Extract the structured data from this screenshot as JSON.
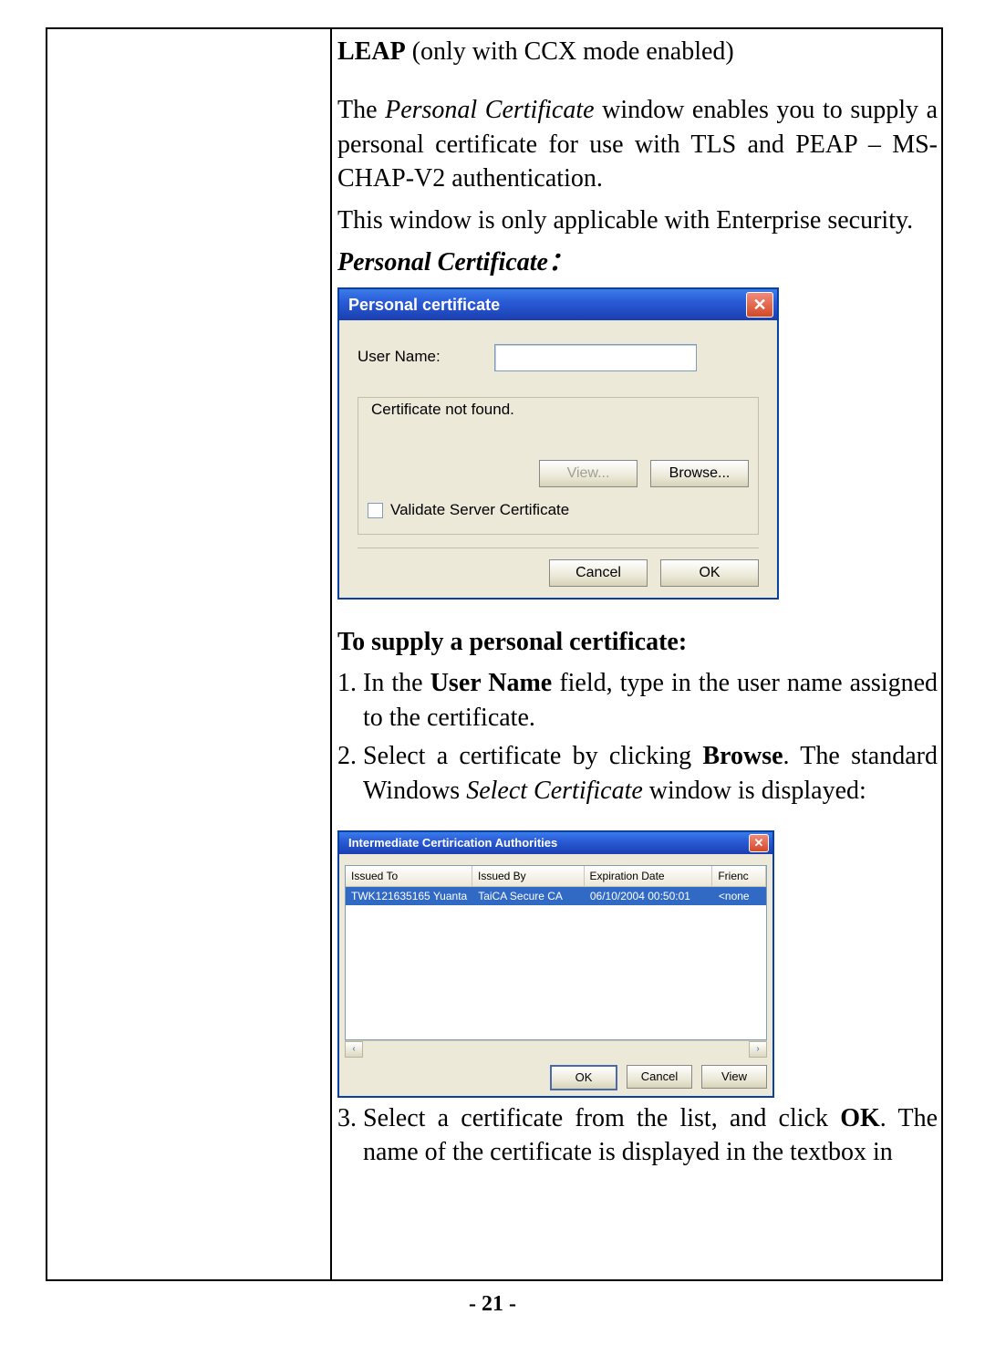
{
  "text": {
    "leap_bold": "LEAP",
    "leap_rest": " (only with CCX mode enabled)",
    "para1_a": "The ",
    "para1_b": "Personal Certificate",
    "para1_c": " window enables you to supply a personal certificate for use with TLS and PEAP – MS-CHAP-V2 authentication.",
    "para2": "This window is only applicable with Enterprise security.",
    "pcert_heading": "Personal Certificate：",
    "supply_heading": "To supply a personal certificate:",
    "li1_a": "In the ",
    "li1_b": "User Name",
    "li1_c": " field, type in the user name assigned to the certificate.",
    "li2_a": "Select a certificate by clicking ",
    "li2_b": "Browse",
    "li2_c": ". The standard Windows ",
    "li2_d": "Select Certificate",
    "li2_e": " window is displayed:",
    "li3_a": "Select a certificate from the list, and click ",
    "li3_b": "OK",
    "li3_c": ". The name of the certificate is displayed in the textbox in",
    "page_num": "- 21 -"
  },
  "dlg1": {
    "title": "Personal certificate",
    "user_name_lbl": "User Name:",
    "cert_not_found": "Certificate not found.",
    "view_btn": "View...",
    "browse_btn": "Browse...",
    "validate_lbl": "Validate Server Certificate",
    "cancel_btn": "Cancel",
    "ok_btn": "OK"
  },
  "dlg2": {
    "title": "Intermediate Certirication Authorities",
    "hdr_issued_to": "Issued To",
    "hdr_issued_by": "Issued By",
    "hdr_exp": "Expiration Date",
    "hdr_friendly": "Frienc",
    "row_issued_to": "TWK121635165 Yuanta",
    "row_issued_by": "TaiCA Secure CA",
    "row_exp": "06/10/2004 00:50:01",
    "row_friendly": "<none",
    "ok_btn": "OK",
    "cancel_btn": "Cancel",
    "view_btn": "View"
  }
}
